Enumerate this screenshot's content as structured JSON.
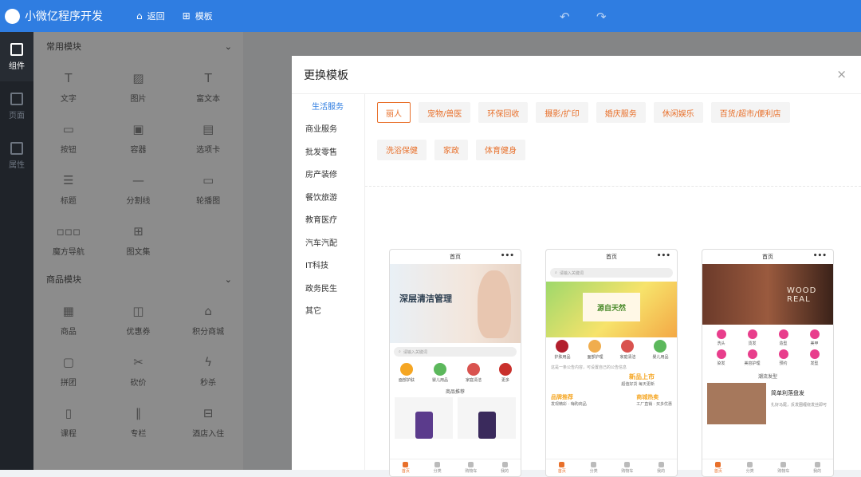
{
  "app": {
    "title": "小微亿程序开发"
  },
  "topbar": {
    "back_label": "返回",
    "template_label": "模板"
  },
  "rail": [
    {
      "label": "组件",
      "active": true
    },
    {
      "label": "页面",
      "active": false
    },
    {
      "label": "属性",
      "active": false
    }
  ],
  "panel": {
    "sections": [
      {
        "title": "常用模块",
        "items": [
          {
            "label": "文字",
            "icon": "T"
          },
          {
            "label": "图片",
            "icon": "▨"
          },
          {
            "label": "富文本",
            "icon": "T"
          },
          {
            "label": "按钮",
            "icon": "▭"
          },
          {
            "label": "容器",
            "icon": "▣"
          },
          {
            "label": "选项卡",
            "icon": "▤"
          },
          {
            "label": "标题",
            "icon": "☰"
          },
          {
            "label": "分割线",
            "icon": "—"
          },
          {
            "label": "轮播图",
            "icon": "▭"
          },
          {
            "label": "魔方导航",
            "icon": "▫▫▫"
          },
          {
            "label": "图文集",
            "icon": "⊞"
          }
        ]
      },
      {
        "title": "商品模块",
        "items": [
          {
            "label": "商品",
            "icon": "▦"
          },
          {
            "label": "优惠券",
            "icon": "◫"
          },
          {
            "label": "积分商城",
            "icon": "⌂"
          },
          {
            "label": "拼团",
            "icon": "▢"
          },
          {
            "label": "砍价",
            "icon": "✂"
          },
          {
            "label": "秒杀",
            "icon": "ϟ"
          },
          {
            "label": "课程",
            "icon": "▯"
          },
          {
            "label": "专栏",
            "icon": "∥"
          },
          {
            "label": "酒店入住",
            "icon": "⊟"
          }
        ]
      }
    ]
  },
  "modal": {
    "title": "更换模板",
    "close": "×",
    "categories": [
      "生活服务",
      "商业服务",
      "批发零售",
      "房产装修",
      "餐饮旅游",
      "教育医疗",
      "汽车汽配",
      "IT科技",
      "政务民生",
      "其它"
    ],
    "active_category": 0,
    "tags": [
      "丽人",
      "宠物/兽医",
      "环保回收",
      "摄影/扩印",
      "婚庆服务",
      "休闲娱乐",
      "百货/超市/便利店",
      "洗浴保健",
      "家政",
      "体育健身"
    ],
    "active_tag": 0,
    "templates": [
      {
        "page_title": "首页",
        "banner_text": "深层清洁管理",
        "search_placeholder": "请输入关键词",
        "icons": [
          {
            "label": "面部护肤",
            "color": "#f5a623"
          },
          {
            "label": "婴儿用品",
            "color": "#5cb85c"
          },
          {
            "label": "家庭清洁",
            "color": "#d9534f"
          },
          {
            "label": "更多",
            "color": "#c9302c"
          }
        ],
        "section_title": "商品推荐",
        "tabbar": [
          "首页",
          "分类",
          "购物车",
          "我的"
        ]
      },
      {
        "page_title": "首页",
        "search_placeholder": "请输入关键词",
        "banner_text": "源自天然",
        "icons": [
          {
            "label": "护肤用品",
            "color": "#b21f2d"
          },
          {
            "label": "面部护理",
            "color": "#f0ad4e"
          },
          {
            "label": "家庭清洁",
            "color": "#d9534f"
          },
          {
            "label": "婴儿用品",
            "color": "#5cb85c"
          }
        ],
        "notice": "这是一条公告内容，可设置自己的公告信息",
        "new_title": "新品上市",
        "new_sub": "超值好货 每天更新",
        "brand_title": "品牌推荐",
        "brand_sub": "发现精彩 · 嗨购商品",
        "hot_title": "商城热卖",
        "hot_sub": "工厂直销 · 买多优惠",
        "tabbar": [
          "首页",
          "分类",
          "购物车",
          "我的"
        ]
      },
      {
        "page_title": "首页",
        "banner_text": "WOOD REAL",
        "icons": [
          {
            "label": "洗头",
            "color": "#e83e8c"
          },
          {
            "label": "烫发",
            "color": "#e83e8c"
          },
          {
            "label": "造型",
            "color": "#e83e8c"
          },
          {
            "label": "美甲",
            "color": "#e83e8c"
          },
          {
            "label": "染发",
            "color": "#e83e8c"
          },
          {
            "label": "美容护理",
            "color": "#e83e8c"
          },
          {
            "label": "预约",
            "color": "#e83e8c"
          },
          {
            "label": "发型",
            "color": "#e83e8c"
          }
        ],
        "section_title": "潮流发型",
        "card_title": "简单利落盘发",
        "card_sub": "扎好马尾，反发圈缠绕发丝即可",
        "tabbar": [
          "首页",
          "分类",
          "购物车",
          "我的"
        ]
      }
    ]
  }
}
